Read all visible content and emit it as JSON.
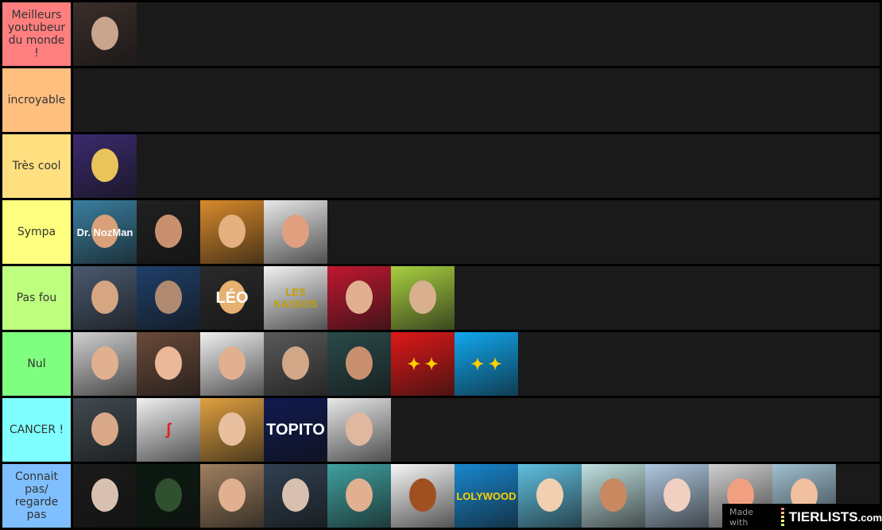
{
  "tiers": [
    {
      "label": "Meilleurs youtubeur du monde !",
      "color": "#ff7f7f",
      "items": [
        {
          "bg": "#3a2e2a",
          "face": "#c9a58e"
        }
      ]
    },
    {
      "label": "incroyable",
      "color": "#ffbf7f",
      "items": []
    },
    {
      "label": "Très cool",
      "color": "#ffdf7f",
      "items": [
        {
          "bg": "#3b2a6e",
          "face": "#e9c45a"
        }
      ]
    },
    {
      "label": "Sympa",
      "color": "#ffff7f",
      "items": [
        {
          "bg": "#3a7fa0",
          "face": "#d9a07a",
          "text": "Dr. NozMan",
          "tc": "#fff"
        },
        {
          "bg": "#202020",
          "face": "#c99070"
        },
        {
          "bg": "#d88a2a",
          "face": "#e4b080"
        },
        {
          "bg": "#e8e8e8",
          "face": "#e0a080"
        }
      ]
    },
    {
      "label": "Pas fou",
      "color": "#bfff7f",
      "items": [
        {
          "bg": "#4a5a70",
          "face": "#d6a582"
        },
        {
          "bg": "#1f3f6a",
          "face": "#b08a70"
        },
        {
          "bg": "#2a2a2a",
          "face": "#e6b070",
          "text": "LÉO",
          "tc": "#fff"
        },
        {
          "bg": "#f2f2f2",
          "text": "LES KASSOS",
          "tc": "#c0a000"
        },
        {
          "bg": "#c01830",
          "face": "#e0b090"
        },
        {
          "bg": "#a8d040",
          "face": "#d8b090"
        }
      ]
    },
    {
      "label": "Nul",
      "color": "#7fff7f",
      "items": [
        {
          "bg": "#d0d0d0",
          "face": "#e0b090"
        },
        {
          "bg": "#6a4a3a",
          "face": "#e8b898"
        },
        {
          "bg": "#f0f0f0",
          "face": "#e0b090"
        },
        {
          "bg": "#5a5a5a",
          "face": "#d0a888"
        },
        {
          "bg": "#2a4a4a",
          "face": "#c89070"
        },
        {
          "bg": "#e01818",
          "text": "✦ ✦",
          "tc": "#ffd000"
        },
        {
          "bg": "#10a8f0",
          "text": "✦ ✦",
          "tc": "#ffd000"
        }
      ]
    },
    {
      "label": "CANCER !",
      "color": "#7fffff",
      "items": [
        {
          "bg": "#404a50",
          "face": "#d8a888"
        },
        {
          "bg": "#f0f0f0",
          "text": "ʃ",
          "tc": "#e02020"
        },
        {
          "bg": "#e0a040",
          "face": "#e8c0a0"
        },
        {
          "bg": "#101a50",
          "text": "TOPITO",
          "tc": "#fff"
        },
        {
          "bg": "#e8e8e8",
          "face": "#e0b8a0"
        }
      ]
    },
    {
      "label": "Connait pas/ regarde pas",
      "color": "#7fbfff",
      "items": [
        {
          "bg": "#1a1a1a",
          "face": "#d8c0b0"
        },
        {
          "bg": "#0a1a10",
          "face": "#305030"
        },
        {
          "bg": "#a08060",
          "face": "#e0b090"
        },
        {
          "bg": "#304050",
          "face": "#d8c0b0"
        },
        {
          "bg": "#40a0a0",
          "face": "#e0b090"
        },
        {
          "bg": "#f8f8f8",
          "face": "#a05020"
        },
        {
          "bg": "#1888d0",
          "text": "LOLYWOOD",
          "tc": "#ffd000"
        },
        {
          "bg": "#60c0e0",
          "face": "#f0d0b0"
        },
        {
          "bg": "#c0e0e0",
          "face": "#c88860"
        },
        {
          "bg": "#b0c8e0",
          "face": "#f0d0c0"
        },
        {
          "bg": "#d0d0d0",
          "face": "#f0a080"
        },
        {
          "bg": "#a0c0d0",
          "face": "#f0c0a0"
        }
      ]
    }
  ],
  "watermark": {
    "made_with": "Made with",
    "brand": "TIERLISTS",
    "tld": ".com",
    "bar_colors": [
      "#ff7f7f",
      "#ffbf7f",
      "#ffdf7f",
      "#ffff7f",
      "#bfff7f"
    ]
  }
}
